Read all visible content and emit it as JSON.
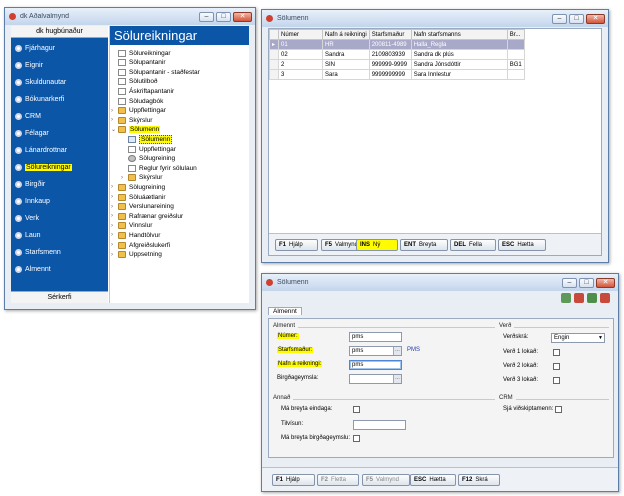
{
  "main_window": {
    "title": "dk Aðalvalmynd",
    "left_header": "dk hugbúnaður",
    "left_footer": "Sérkerfi",
    "menu_items": [
      {
        "label": "Fjárhagur",
        "selected": false
      },
      {
        "label": "Eignir",
        "selected": false
      },
      {
        "label": "Skuldunautar",
        "selected": false
      },
      {
        "label": "Bókunarkerfi",
        "selected": false
      },
      {
        "label": "CRM",
        "selected": false
      },
      {
        "label": "Félagar",
        "selected": false
      },
      {
        "label": "Lánardrottnar",
        "selected": false
      },
      {
        "label": "Sölureikningar",
        "selected": true
      },
      {
        "label": "Birgðir",
        "selected": false
      },
      {
        "label": "Innkaup",
        "selected": false
      },
      {
        "label": "Verk",
        "selected": false
      },
      {
        "label": "Laun",
        "selected": false
      },
      {
        "label": "Starfsmenn",
        "selected": false
      },
      {
        "label": "Almennt",
        "selected": false
      }
    ],
    "right_header": "Sölureikningar",
    "tree": [
      {
        "label": "Sölureikningar",
        "icon": "doc"
      },
      {
        "label": "Sölupantanir",
        "icon": "doc"
      },
      {
        "label": "Sölupantanir - staðfestar",
        "icon": "doc"
      },
      {
        "label": "Sölutilboð",
        "icon": "doc"
      },
      {
        "label": "Áskriftapantanir",
        "icon": "doc"
      },
      {
        "label": "Söludagbók",
        "icon": "doc"
      },
      {
        "label": "Uppflettingar",
        "icon": "folder"
      },
      {
        "label": "Skýrslur",
        "icon": "folder"
      },
      {
        "label": "Sölumenn",
        "icon": "folder"
      },
      {
        "label": "Sölumenn",
        "icon": "form"
      },
      {
        "label": "Uppflettingar",
        "icon": "doc"
      },
      {
        "label": "Sölugreining",
        "icon": "tool"
      },
      {
        "label": "Reglur fyrir sölulaun",
        "icon": "doc"
      },
      {
        "label": "Skýrslur",
        "icon": "folder"
      },
      {
        "label": "Sölugreining",
        "icon": "folder"
      },
      {
        "label": "Söluáætlanir",
        "icon": "folder"
      },
      {
        "label": "Verslunareining",
        "icon": "folder"
      },
      {
        "label": "Rafrænar greiðslur",
        "icon": "folder"
      },
      {
        "label": "Vinnslur",
        "icon": "folder"
      },
      {
        "label": "Handtölvur",
        "icon": "folder"
      },
      {
        "label": "Afgreiðslukerfi",
        "icon": "folder"
      },
      {
        "label": "Uppsetning",
        "icon": "folder"
      }
    ]
  },
  "grid_window": {
    "title": "Sölumenn",
    "columns": [
      "Númer",
      "Nafn á reikningi",
      "Starfsmaður",
      "Nafn starfsmanns",
      "Br..."
    ],
    "rows": [
      [
        "01",
        "HR",
        "200811-4989",
        "Halla_Regla",
        ""
      ],
      [
        "02",
        "Sandra",
        "2109803939",
        "Sandra dk plús",
        ""
      ],
      [
        "2",
        "SIN",
        "999999-9999",
        "Sandra Jónsdóttir",
        "BG1"
      ],
      [
        "3",
        "Sara",
        "9999999999",
        "Sara Innlestur",
        ""
      ]
    ],
    "buttons": [
      {
        "key": "F1",
        "label": "Hjálp"
      },
      {
        "key": "F5",
        "label": "Valmynd"
      },
      {
        "key": "INS",
        "label": "Ný"
      },
      {
        "key": "ENT",
        "label": "Breyta"
      },
      {
        "key": "DEL",
        "label": "Fella"
      },
      {
        "key": "ESC",
        "label": "Hætta"
      }
    ]
  },
  "form_window": {
    "title": "Sölumenn",
    "tab": "Almennt",
    "group_general": "Almennt",
    "number_label": "Númer:",
    "number_value": "pms",
    "employee_label": "Starfsmaður:",
    "employee_value": "pms",
    "employee_name": "PMS",
    "invoice_name_label": "Nafn á reikningi:",
    "invoice_name_value": "pms",
    "warehouse_label": "Birgðageymsla:",
    "warehouse_value": "",
    "group_price": "Verð",
    "price_list_label": "Verðskrá:",
    "price_list_value": "Engin",
    "price1_label": "Verð 1 lokað:",
    "price2_label": "Verð 2 lokað:",
    "price3_label": "Verð 3 lokað:",
    "group_other": "Annað",
    "edit_date_label": "Má breyta eindaga:",
    "reference_label": "Tilvísun:",
    "reference_value": "",
    "edit_warehouse_label": "Má breyta birgðageymslu:",
    "group_crm": "CRM",
    "see_customers_label": "Sjá viðskiptamenn:",
    "buttons": [
      {
        "key": "F1",
        "label": "Hjálp"
      },
      {
        "key": "F2",
        "label": "Fletta"
      },
      {
        "key": "F5",
        "label": "Valmynd"
      },
      {
        "key": "ESC",
        "label": "Hætta"
      },
      {
        "key": "F12",
        "label": "Skrá"
      }
    ]
  },
  "colors": {
    "highlight": "#fffb00",
    "nav_blue": "#0c56a8",
    "selected_row": "#a8a8c8"
  }
}
